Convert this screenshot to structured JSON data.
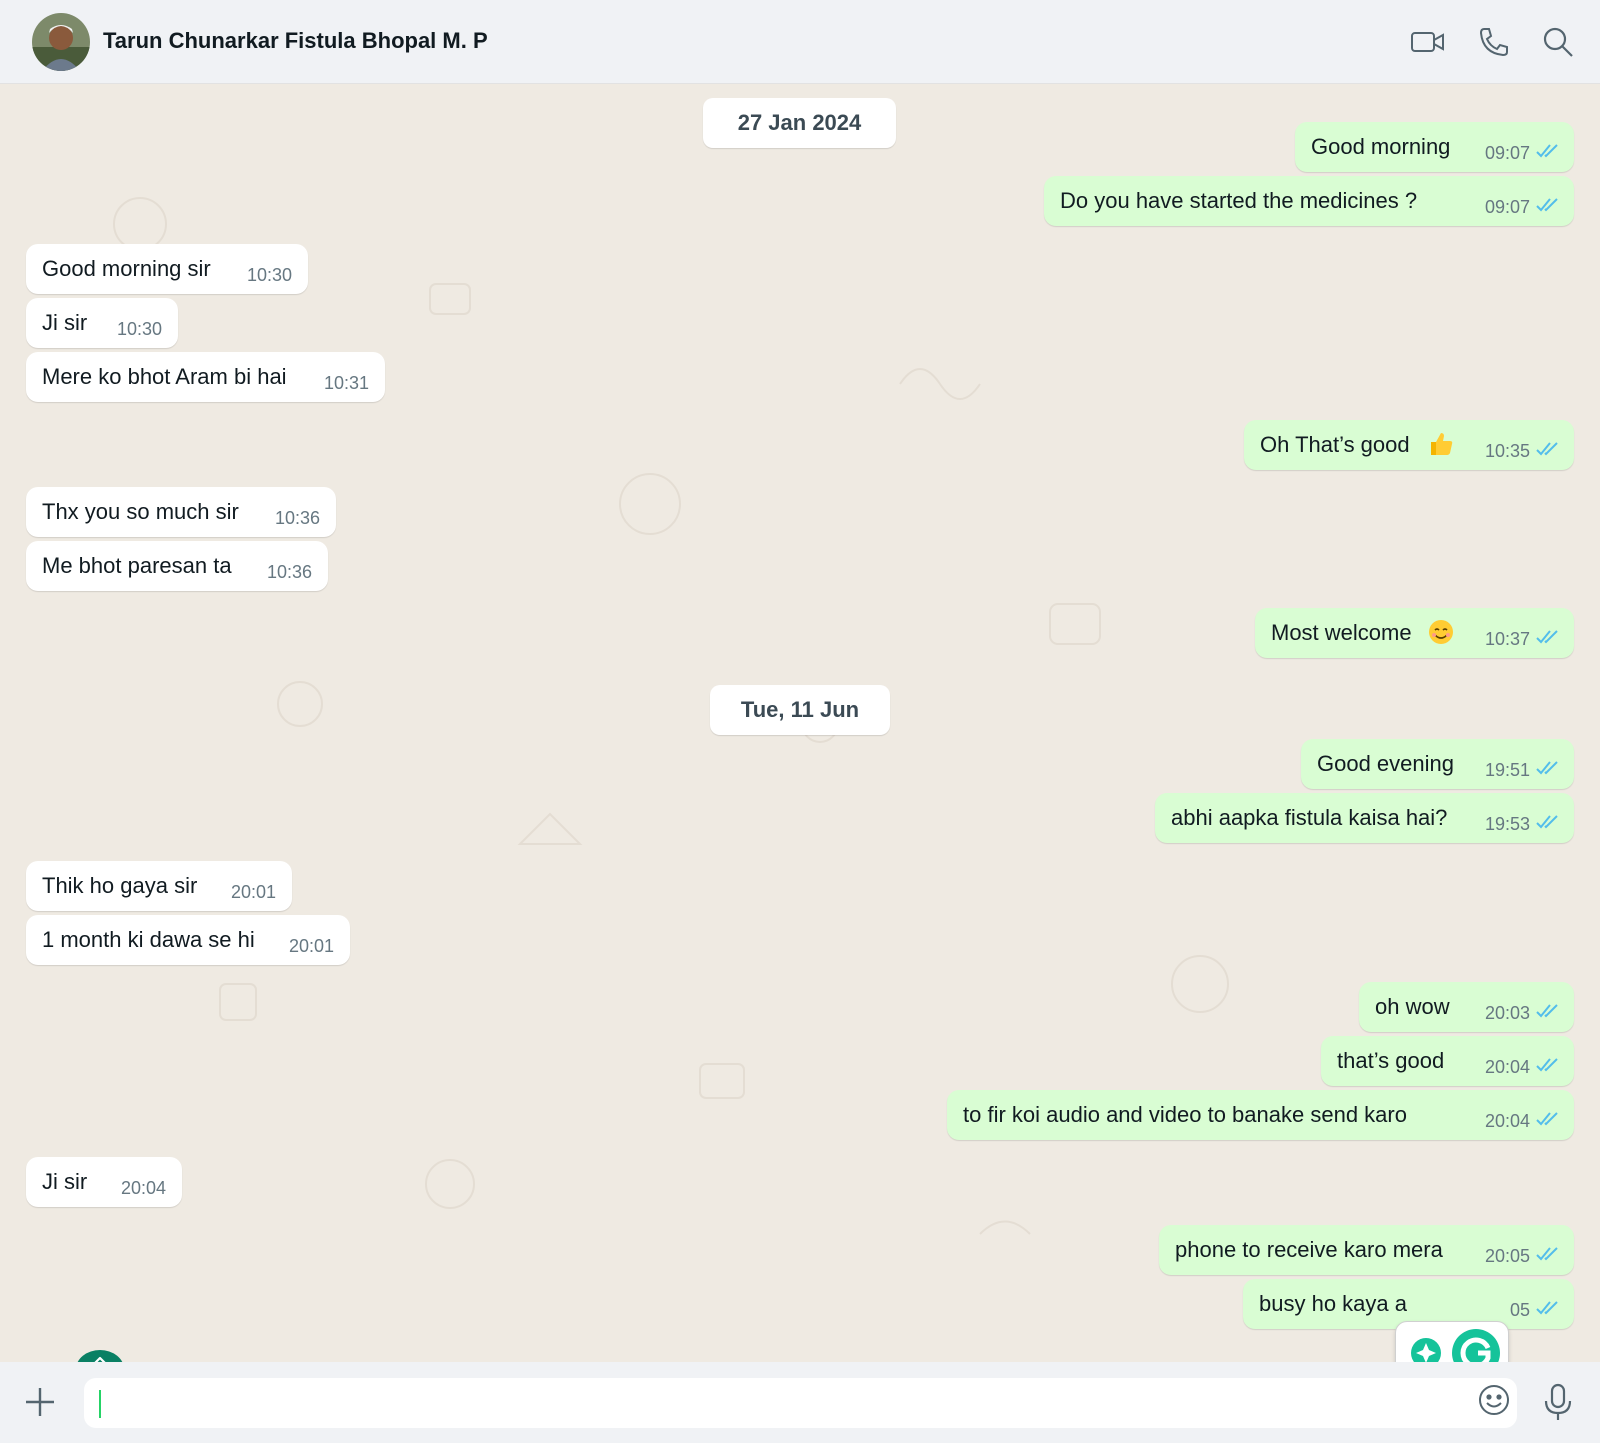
{
  "header": {
    "contact_name": "Tarun Chunarkar Fistula Bhopal M. P",
    "icons": [
      "video-call-icon",
      "voice-call-icon",
      "search-icon"
    ]
  },
  "dates": [
    "27 Jan 2024",
    "Tue, 11 Jun"
  ],
  "messages": [
    {
      "dir": "out",
      "text": "Good morning",
      "time": "09:07",
      "status": "read"
    },
    {
      "dir": "out",
      "text": "Do you have started the medicines ?",
      "time": "09:07",
      "status": "read"
    },
    {
      "dir": "in",
      "text": "Good morning sir",
      "time": "10:30"
    },
    {
      "dir": "in",
      "text": "Ji sir",
      "time": "10:30"
    },
    {
      "dir": "in",
      "text": "Mere ko bhot Aram bi hai",
      "time": "10:31"
    },
    {
      "dir": "out",
      "text": "Oh That’s good",
      "emoji": "thumbs-up",
      "time": "10:35",
      "status": "read"
    },
    {
      "dir": "in",
      "text": "Thx you so much sir",
      "time": "10:36"
    },
    {
      "dir": "in",
      "text": "Me bhot paresan ta",
      "time": "10:36"
    },
    {
      "dir": "out",
      "text": "Most welcome",
      "emoji": "smiling-face",
      "time": "10:37",
      "status": "read"
    },
    {
      "dir": "out",
      "text": "Good evening",
      "time": "19:51",
      "status": "read"
    },
    {
      "dir": "out",
      "text": "abhi aapka fistula kaisa hai?",
      "time": "19:53",
      "status": "read"
    },
    {
      "dir": "in",
      "text": "Thik ho gaya sir",
      "time": "20:01"
    },
    {
      "dir": "in",
      "text": "1 month ki dawa se hi",
      "time": "20:01"
    },
    {
      "dir": "out",
      "text": "oh wow",
      "time": "20:03",
      "status": "read"
    },
    {
      "dir": "out",
      "text": "that’s good",
      "time": "20:04",
      "status": "read"
    },
    {
      "dir": "out",
      "text": "to fir koi audio and video to banake send karo",
      "time": "20:04",
      "status": "read"
    },
    {
      "dir": "in",
      "text": "Ji sir",
      "time": "20:04"
    },
    {
      "dir": "out",
      "text": "phone to receive karo mera",
      "time": "20:05",
      "status": "read"
    },
    {
      "dir": "out",
      "text": "busy ho kaya a",
      "time": "05",
      "status": "read"
    }
  ],
  "composer": {
    "value": "",
    "icons": [
      "plus-icon",
      "emoji-icon",
      "microphone-icon"
    ]
  },
  "colors": {
    "chat_bg": "#efeae2",
    "incoming_bubble": "#ffffff",
    "outgoing_bubble": "#d9fdd3",
    "read_ticks": "#53bdeb",
    "header_bg": "#f0f2f5"
  }
}
